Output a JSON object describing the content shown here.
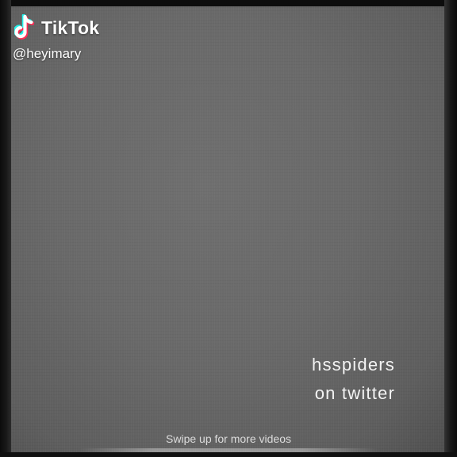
{
  "brand": {
    "name": "TikTok",
    "icon": "tiktok-note-icon",
    "colors": {
      "cyan": "#25F4EE",
      "red": "#FE2C55",
      "white": "#FFFFFF"
    }
  },
  "video": {
    "author_handle": "@heyimary",
    "caption_lines": [
      "hsspiders",
      "on twitter"
    ]
  },
  "footer": {
    "swipe_hint": "Swipe up for more videos"
  }
}
